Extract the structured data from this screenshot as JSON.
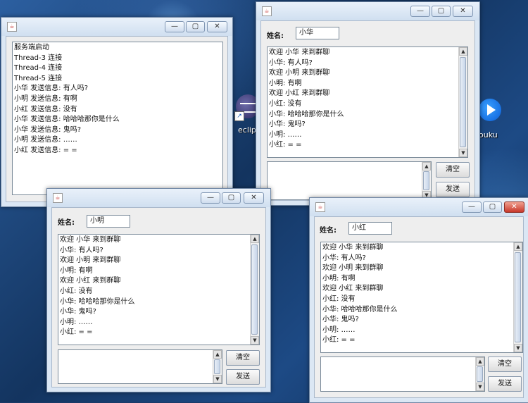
{
  "desktop": {
    "eclipse_label": "eclip",
    "youku_label": "ouku"
  },
  "window_controls": {
    "minimize": "—",
    "maximize": "▢",
    "close": "✕"
  },
  "server": {
    "log": [
      "服务端启动",
      "Thread-3 连接",
      "Thread-4 连接",
      "Thread-5 连接",
      "小华 发送信息: 有人吗?",
      "小明 发送信息: 有啊",
      "小红 发送信息: 没有",
      "小华 发送信息: 哈哈哈那你是什么",
      "小华 发送信息: 鬼吗?",
      "小明 发送信息: ……",
      "小红 发送信息: = ="
    ]
  },
  "chat_common": {
    "name_label": "姓名:",
    "clear_button": "清空",
    "send_button": "发送",
    "messages": [
      "欢迎 小华 来到群聊",
      "小华: 有人吗?",
      "欢迎 小明 来到群聊",
      "小明: 有啊",
      "欢迎 小红 来到群聊",
      "小红: 没有",
      "小华: 哈哈哈那你是什么",
      "小华: 鬼吗?",
      "小明: ……",
      "小红: = ="
    ]
  },
  "clients": [
    {
      "name": "小华",
      "input": ""
    },
    {
      "name": "小明",
      "input": ""
    },
    {
      "name": "小红",
      "input": ""
    }
  ]
}
